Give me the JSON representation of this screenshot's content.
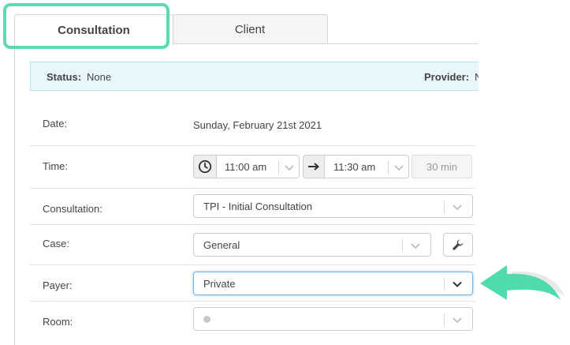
{
  "tabs": {
    "consultation": "Consultation",
    "client": "Client",
    "highlight_color": "#5fd9ad"
  },
  "status": {
    "status_label": "Status:",
    "status_value": "None",
    "provider_label": "Provider:",
    "provider_value": "N"
  },
  "form": {
    "date": {
      "label": "Date:",
      "value": "Sunday, February 21st 2021"
    },
    "time": {
      "label": "Time:",
      "start": "11:00 am",
      "end": "11:30 am",
      "duration": "30 min",
      "start_icon": "clock-icon",
      "end_icon": "arrow-right-icon"
    },
    "consultation": {
      "label": "Consultation:",
      "value": "TPI - Initial Consultation"
    },
    "case": {
      "label": "Case:",
      "value": "General",
      "button_icon": "wrench-icon"
    },
    "payer": {
      "label": "Payer:",
      "value": "Private"
    },
    "room": {
      "label": "Room:",
      "value": ""
    }
  },
  "annotation": {
    "pointer": "green-arrow-icon",
    "color": "#4fdcaa"
  }
}
